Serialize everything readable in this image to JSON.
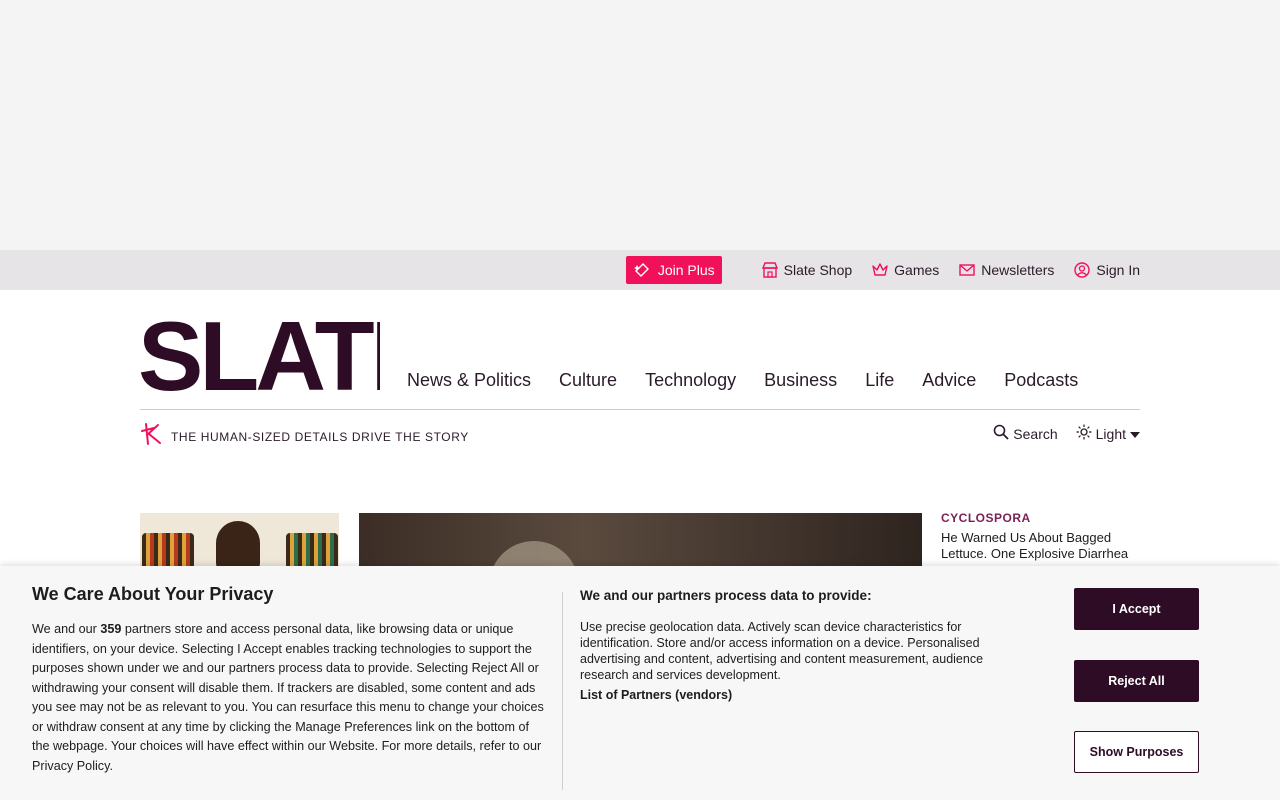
{
  "utility": {
    "join_plus": "Join Plus",
    "links": [
      {
        "label": "Slate Shop",
        "icon": "shop-icon"
      },
      {
        "label": "Games",
        "icon": "crown-icon"
      },
      {
        "label": "Newsletters",
        "icon": "envelope-icon"
      },
      {
        "label": "Sign In",
        "icon": "user-icon"
      }
    ]
  },
  "header": {
    "logo_text": "SLATE",
    "nav": [
      "News & Politics",
      "Culture",
      "Technology",
      "Business",
      "Life",
      "Advice",
      "Podcasts"
    ],
    "tagline": "THE HUMAN-SIZED DETAILS DRIVE THE STORY",
    "search": "Search",
    "theme": "Light"
  },
  "side_story": {
    "kicker": "CYCLOSPORA",
    "headline": "He Warned Us About Bagged Lettuce. One Explosive Diarrhea"
  },
  "privacy": {
    "title": "We Care About Your Privacy",
    "body_pre": "We and our ",
    "partner_count": "359",
    "body_post": " partners store and access personal data, like browsing data or unique identifiers, on your device. Selecting I Accept enables tracking technologies to support the purposes shown under we and our partners process data to provide. Selecting Reject All or withdrawing your consent will disable them. If trackers are disabled, some content and ads you see may not be as relevant to you. You can resurface this menu to change your choices or withdraw consent at any time by clicking the Manage Preferences link on the bottom of the webpage. Your choices will have effect within our Website. For more details, refer to our Privacy Policy.",
    "purposes_title": "We and our partners process data to provide:",
    "purposes_text": "Use precise geolocation data. Actively scan device characteristics for identification. Store and/or access information on a device. Personalised advertising and content, advertising and content measurement, audience research and services development.",
    "partners_link": "List of Partners (vendors)",
    "accept": "I Accept",
    "reject": "Reject All",
    "show_purposes": "Show Purposes"
  },
  "colors": {
    "brand": "#2e0c25",
    "accent": "#f0115a",
    "kicker": "#7b1f54"
  }
}
